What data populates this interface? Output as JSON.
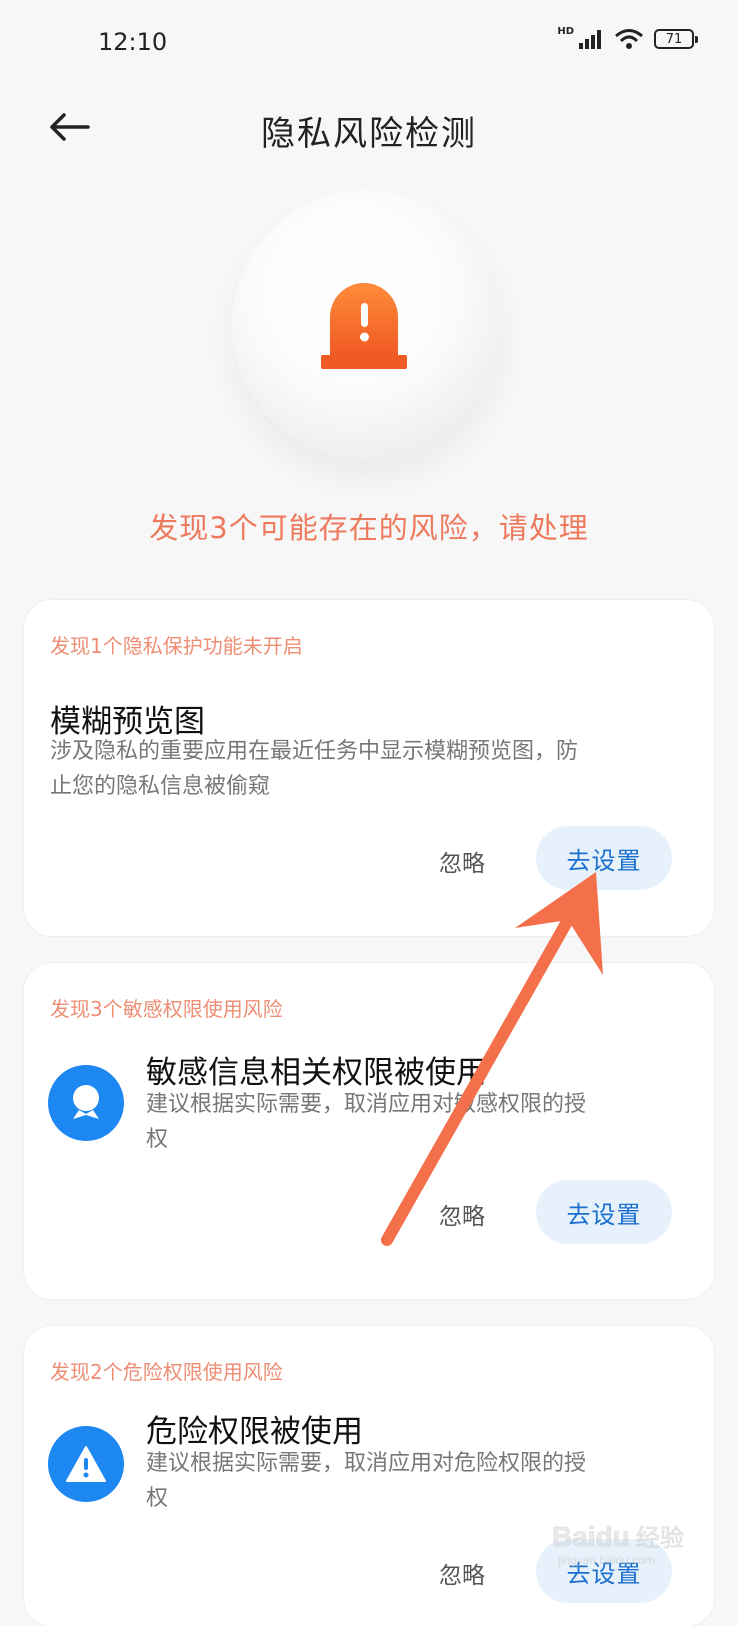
{
  "status": {
    "time": "12:10",
    "network": "HD",
    "battery": "71"
  },
  "header": {
    "title": "隐私风险检测"
  },
  "summary": {
    "text": "发现3个可能存在的风险，请处理"
  },
  "cards": [
    {
      "heading": "发现1个隐私保护功能未开启",
      "title": "模糊预览图",
      "desc_line1": "涉及隐私的重要应用在最近任务中显示模糊预览图，防",
      "desc_line2": "止您的隐私信息被偷窥",
      "ignore_label": "忽略",
      "setup_label": "去设置"
    },
    {
      "heading": "发现3个敏感权限使用风险",
      "title": "敏感信息相关权限被使用",
      "desc_line1": "建议根据实际需要，取消应用对敏感权限的授",
      "desc_line2": "权",
      "ignore_label": "忽略",
      "setup_label": "去设置"
    },
    {
      "heading": "发现2个危险权限使用风险",
      "title": "危险权限被使用",
      "desc_line1": "建议根据实际需要，取消应用对危险权限的授",
      "desc_line2": "权",
      "ignore_label": "忽略",
      "setup_label": "去设置"
    }
  ],
  "watermark": {
    "brand": "Baidu",
    "suffix": "经验",
    "url": "jingyan.baidu.com"
  },
  "colors": {
    "accent_orange": "#ee7a5e",
    "button_blue": "#1a6fcf",
    "icon_blue": "#1e88f2",
    "alarm_orange": "#f26b2e"
  }
}
